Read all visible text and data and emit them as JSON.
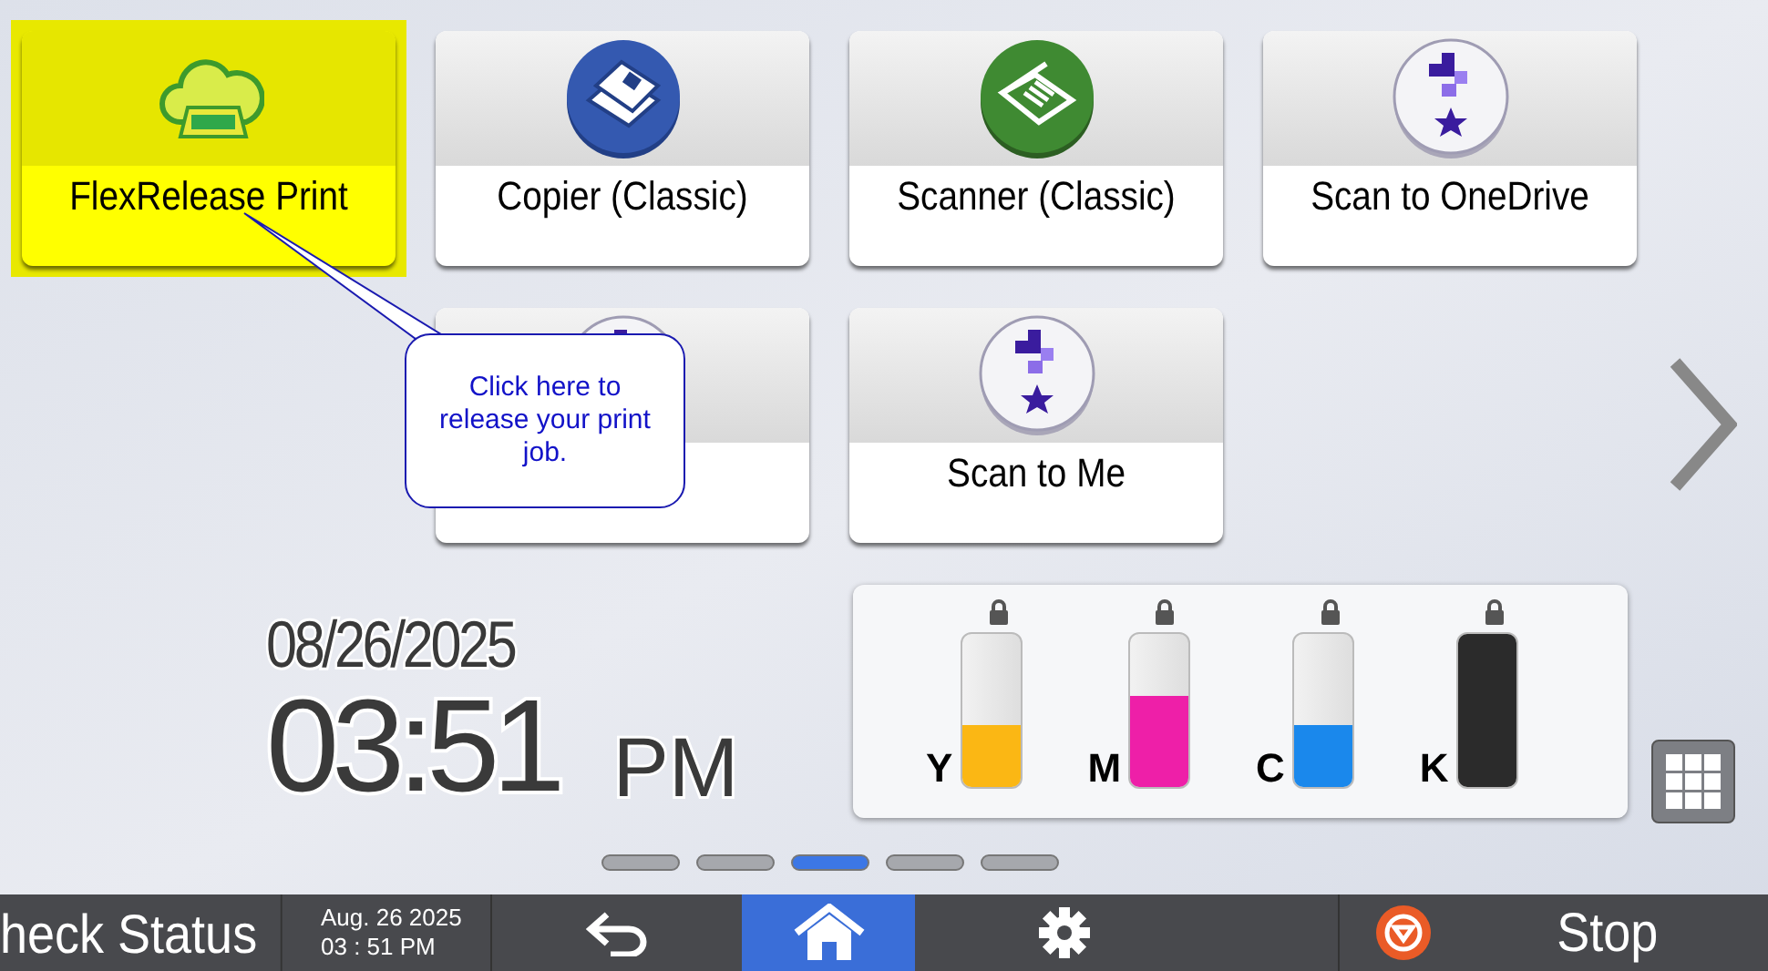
{
  "tiles": [
    {
      "label": "FlexRelease Print",
      "kind": "cloud",
      "selected": true
    },
    {
      "label": "Copier (Classic)",
      "kind": "copier",
      "selected": false
    },
    {
      "label": "Scanner (Classic)",
      "kind": "scanner",
      "selected": false
    },
    {
      "label": "Scan to OneDrive",
      "kind": "app",
      "selected": false
    },
    {
      "kind": "app",
      "selected": false
    },
    {
      "label": "Scan to Me",
      "kind": "app",
      "selected": false
    }
  ],
  "callout": {
    "text": "Click here to release your print job."
  },
  "clock": {
    "date": "08/26/2025",
    "time": "03:51",
    "ampm": "PM"
  },
  "toner": [
    {
      "label": "Y",
      "color": "#fbb714",
      "level": 0.4
    },
    {
      "label": "M",
      "color": "#ee1fa8",
      "level": 0.6
    },
    {
      "label": "C",
      "color": "#1a88ec",
      "level": 0.4
    },
    {
      "label": "K",
      "color": "#2b2b2b",
      "level": 1.0
    }
  ],
  "pages": [
    {
      "selected": false
    },
    {
      "selected": false
    },
    {
      "selected": true
    },
    {
      "selected": false
    },
    {
      "selected": false
    }
  ],
  "bottom_bar": {
    "status": "heck Status",
    "date": "Aug. 26 2025",
    "time": "03 : 51 PM",
    "home_selected": true,
    "stop": "Stop"
  }
}
